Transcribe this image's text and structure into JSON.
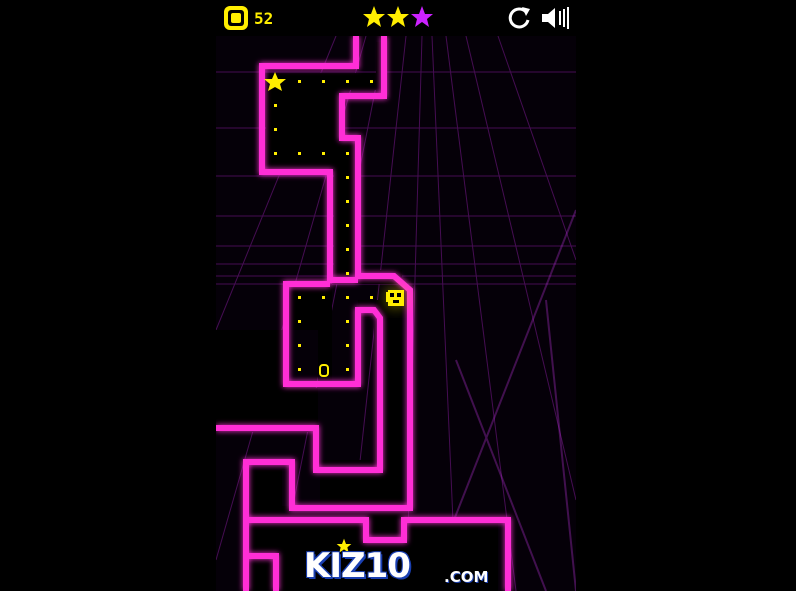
{
  "hud": {
    "coin_count": "52",
    "stars": [
      {
        "state": "earned",
        "color": "#ffee00"
      },
      {
        "state": "earned",
        "color": "#ffee00"
      },
      {
        "state": "not-earned",
        "color": "#cc22ff"
      }
    ],
    "restart_icon": "restart-icon",
    "sound_icon": "speaker-icon"
  },
  "logo": {
    "brand_text": "KIZ10",
    "suffix_text": ".COM"
  },
  "colors": {
    "wall": "#ff2fd6",
    "wall_glow": "#c400b0",
    "dot": "#ffee00",
    "player": "#ffee00",
    "grid": "#7a1890",
    "background": "#050008"
  }
}
